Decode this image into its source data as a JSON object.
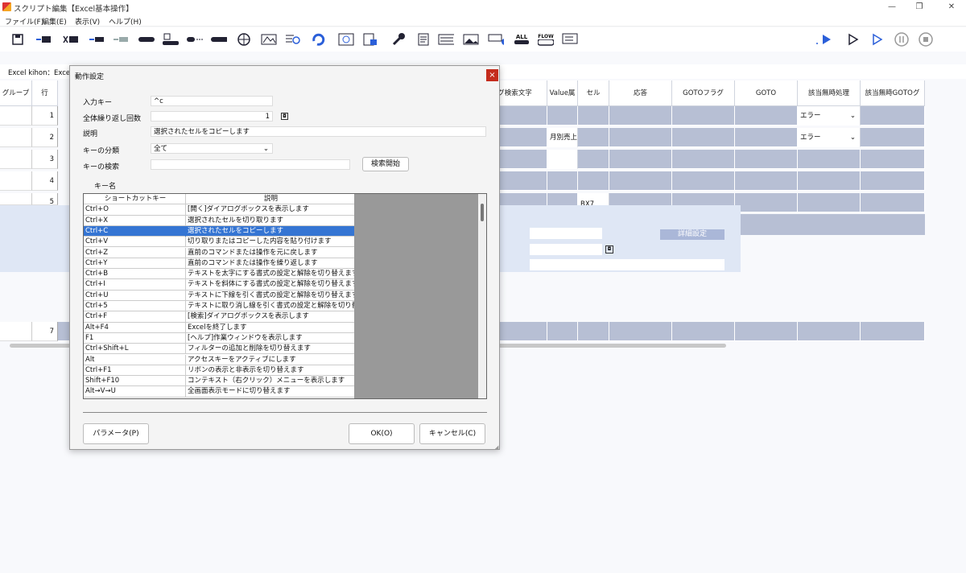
{
  "window": {
    "title": "スクリプト編集【Excel基本操作】",
    "minimize": "—",
    "restore": "❐",
    "close": "✕"
  },
  "menu": [
    "ファイル(F)",
    "編集(E)",
    "表示(V)",
    "ヘルプ(H)"
  ],
  "toolbar_icons": [
    "save-icon",
    "insert-step-icon",
    "delete-step-icon",
    "move-up-icon",
    "move-down-icon",
    "key-icon",
    "text-input-icon",
    "mouse-click-icon",
    "wait-icon",
    "web-icon",
    "image-search-icon",
    "search-icon",
    "loop-icon",
    "screen-capture-icon",
    "file-icon",
    "settings-icon",
    "document-icon",
    "keyboard-icon",
    "image-icon",
    "add-condition-icon",
    "all-icon",
    "flow-icon",
    "list-icon"
  ],
  "run_controls": [
    "run-icon",
    "step-run-icon",
    "run-from-icon",
    "pause-icon",
    "stop-icon"
  ],
  "path": "Excel kihon：Exce",
  "grid": {
    "headers": {
      "group": "グループ",
      "row": "行",
      "search_text": "グ検索文字",
      "value": "Value属",
      "cell": "セル",
      "response": "応答",
      "goto_flag": "GOTOフラグ",
      "goto": "GOTO",
      "nomatch": "該当無時処理",
      "nomatch_goto": "該当無時GOTOグ"
    },
    "rows": [
      {
        "num": "1",
        "value": "",
        "cell": "",
        "nomatch": "エラー"
      },
      {
        "num": "2",
        "value": "月別売上",
        "cell": "",
        "nomatch": "エラー"
      },
      {
        "num": "3",
        "value": "",
        "cell": "",
        "nomatch": ""
      },
      {
        "num": "4",
        "value": "",
        "cell": "",
        "nomatch": ""
      },
      {
        "num": "5",
        "value": "",
        "cell": "BX7",
        "nomatch": ""
      },
      {
        "num": "7",
        "value": "",
        "cell": "",
        "nomatch": ""
      }
    ],
    "detail_button": "詳細設定"
  },
  "dialog": {
    "title": "動作設定",
    "close": "×",
    "input_key_label": "入力キー",
    "input_key_value": "^c",
    "repeat_label": "全体繰り返し回数",
    "repeat_value": "1",
    "desc_label": "説明",
    "desc_value": "選択されたセルをコピーします",
    "category_label": "キーの分類",
    "category_value": "全て",
    "search_label": "キーの検索",
    "search_value": "",
    "search_button": "検索開始",
    "keyname_label": "キー名",
    "table_headers": [
      "ショートカットキー",
      "説明"
    ],
    "keys": [
      {
        "key": "Ctrl+O",
        "desc": "[開く]ダイアログボックスを表示します"
      },
      {
        "key": "Ctrl+X",
        "desc": "選択されたセルを切り取ります"
      },
      {
        "key": "Ctrl+C",
        "desc": "選択されたセルをコピーします"
      },
      {
        "key": "Ctrl+V",
        "desc": "切り取りまたはコピーした内容を貼り付けます"
      },
      {
        "key": "Ctrl+Z",
        "desc": "直前のコマンドまたは操作を元に戻します"
      },
      {
        "key": "Ctrl+Y",
        "desc": "直前のコマンドまたは操作を繰り返します"
      },
      {
        "key": "Ctrl+B",
        "desc": "テキストを太字にする書式の設定と解除を切り替えます"
      },
      {
        "key": "Ctrl+I",
        "desc": "テキストを斜体にする書式の設定と解除を切り替えます"
      },
      {
        "key": "Ctrl+U",
        "desc": "テキストに下線を引く書式の設定と解除を切り替えます"
      },
      {
        "key": "Ctrl+5",
        "desc": "テキストに取り消し線を引く書式の設定と解除を切り替..."
      },
      {
        "key": "Ctrl+F",
        "desc": "[検索]ダイアログボックスを表示します"
      },
      {
        "key": "Alt+F4",
        "desc": "Excelを終了します"
      },
      {
        "key": "F1",
        "desc": "[ヘルプ]作業ウィンドウを表示します"
      },
      {
        "key": "Ctrl+Shift+L",
        "desc": "フィルターの追加と削除を切り替えます"
      },
      {
        "key": "Alt",
        "desc": "アクセスキーをアクティブにします"
      },
      {
        "key": "Ctrl+F1",
        "desc": "リボンの表示と非表示を切り替えます"
      },
      {
        "key": "Shift+F10",
        "desc": "コンテキスト（右クリック）メニューを表示します"
      },
      {
        "key": "Alt→V→U",
        "desc": "全画面表示モードに切り替えます"
      }
    ],
    "param_button": "パラメータ(P)",
    "ok_button": "OK(O)",
    "cancel_button": "キャンセル(C)"
  }
}
